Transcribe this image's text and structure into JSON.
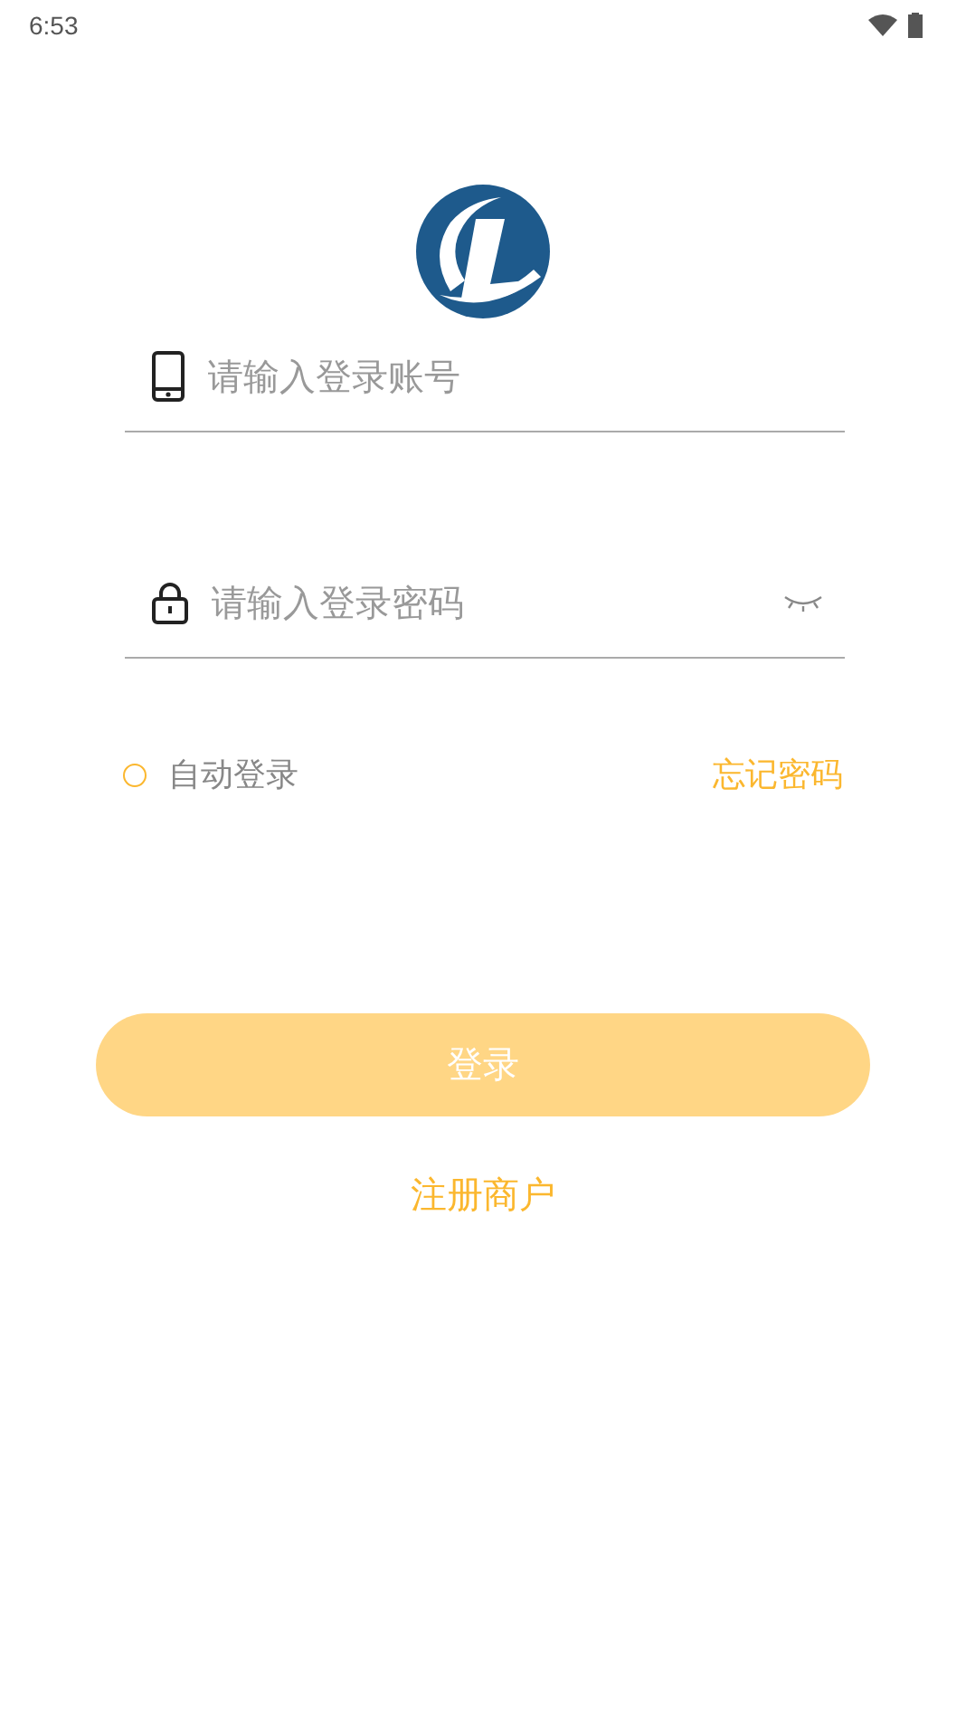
{
  "status_bar": {
    "time": "6:53"
  },
  "fields": [
    {
      "kind": "phone",
      "placeholder": "请输入登录账号"
    },
    {
      "kind": "password",
      "placeholder": "请输入登录密码",
      "password_visible": false
    }
  ],
  "auto_login": {
    "label": "自动登录",
    "checked": false
  },
  "forgot_password": "忘记密码",
  "login_button": "登录",
  "register_link": "注册商户"
}
